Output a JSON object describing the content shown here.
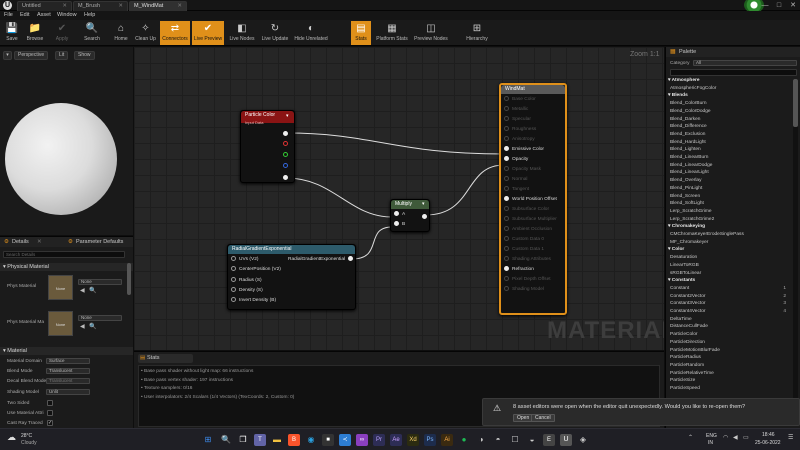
{
  "window": {
    "tabs": [
      "Untitled",
      "M_Brush",
      "M_WindMat"
    ],
    "controls": [
      "—",
      "□",
      "✕"
    ]
  },
  "menu": [
    "File",
    "Edit",
    "Asset",
    "Window",
    "Help"
  ],
  "toolbar": [
    {
      "label": "Save",
      "icon": "💾",
      "state": "normal"
    },
    {
      "label": "Browse",
      "icon": "📁",
      "state": "normal"
    },
    {
      "label": "Apply",
      "icon": "✔",
      "state": "disabled"
    },
    {
      "label": "Search",
      "icon": "🔍",
      "state": "normal"
    },
    {
      "label": "Home",
      "icon": "⌂",
      "state": "normal"
    },
    {
      "label": "Clean Up",
      "icon": "✧",
      "state": "normal"
    },
    {
      "label": "Connectors",
      "icon": "⇄",
      "state": "active"
    },
    {
      "label": "Live Preview",
      "icon": "✔",
      "state": "active"
    },
    {
      "label": "Live Nodes",
      "icon": "◧",
      "state": "normal"
    },
    {
      "label": "Live Update",
      "icon": "↻",
      "state": "normal"
    },
    {
      "label": "Hide Unrelated",
      "icon": "◐",
      "state": "normal"
    },
    {
      "label": "Stats",
      "icon": "▤",
      "state": "active"
    },
    {
      "label": "Platform Stats",
      "icon": "▦",
      "state": "normal"
    },
    {
      "label": "Preview Nodes",
      "icon": "◫",
      "state": "normal"
    },
    {
      "label": "Hierarchy",
      "icon": "⊞",
      "state": "normal"
    }
  ],
  "viewport": {
    "buttons": [
      "Perspective",
      "Lit",
      "Show"
    ]
  },
  "details": {
    "tabs": [
      "Details",
      "Parameter Defaults"
    ],
    "search_placeholder": "Search Details",
    "section_physical": "Physical Material",
    "phys_material_label": "Phys Material",
    "phys_material_mask_label": "Phys Material Ma",
    "thumb_label": "None",
    "none_value": "None",
    "section_material": "Material",
    "rows": [
      {
        "label": "Material Domain",
        "value": "Surface"
      },
      {
        "label": "Blend Mode",
        "value": "Translucent"
      },
      {
        "label": "Decal Blend Mode",
        "value": "Translucent"
      },
      {
        "label": "Shading Model",
        "value": "Unlit"
      },
      {
        "label": "Two Sided",
        "value": ""
      },
      {
        "label": "Use Material Attri",
        "value": ""
      },
      {
        "label": "Cast Ray Traced",
        "value": "✓"
      }
    ]
  },
  "graph": {
    "zoom": "Zoom 1:1",
    "watermark": "MATERIAL",
    "particle_color": {
      "title": "Particle Color",
      "subtitle": "Input Data"
    },
    "multiply": {
      "title": "Multiply",
      "pins": [
        "A",
        "B"
      ]
    },
    "radial": {
      "title": "RadialGradientExponential",
      "output": "RadialGradientExponential",
      "pins": [
        "UVs (V2)",
        "CenterPosition (V2)",
        "Radius (S)",
        "Density (S)",
        "Invert Density (B)"
      ]
    },
    "windmat": {
      "title": "WindMat",
      "pins": [
        {
          "label": "Base Color",
          "enabled": false
        },
        {
          "label": "Metallic",
          "enabled": false
        },
        {
          "label": "Specular",
          "enabled": false
        },
        {
          "label": "Roughness",
          "enabled": false
        },
        {
          "label": "Anisotropy",
          "enabled": false
        },
        {
          "label": "Emissive Color",
          "enabled": true
        },
        {
          "label": "Opacity",
          "enabled": true
        },
        {
          "label": "Opacity Mask",
          "enabled": false
        },
        {
          "label": "Normal",
          "enabled": false
        },
        {
          "label": "Tangent",
          "enabled": false
        },
        {
          "label": "World Position Offset",
          "enabled": true
        },
        {
          "label": "Subsurface Color",
          "enabled": false
        },
        {
          "label": "Subsurface Multiplier",
          "enabled": false
        },
        {
          "label": "Ambient Occlusion",
          "enabled": false
        },
        {
          "label": "Custom Data 0",
          "enabled": false
        },
        {
          "label": "Custom Data 1",
          "enabled": false
        },
        {
          "label": "Shading Attributes",
          "enabled": false
        },
        {
          "label": "Refraction",
          "enabled": true
        },
        {
          "label": "Pixel Depth Offset",
          "enabled": false
        },
        {
          "label": "Shading Model",
          "enabled": false
        }
      ]
    }
  },
  "stats": {
    "tab": "Stats",
    "lines": [
      "Base pass shader without light map: 66 instructions",
      "Base pass vertex shader: 197 instructions",
      "Texture samplers: 0/16",
      "User interpolators: 2/4 Scalars (1/4 Vectors) (TexCoords: 2, Custom: 0)"
    ]
  },
  "palette": {
    "title": "Palette",
    "category_label": "Category",
    "category_value": "All",
    "items": [
      {
        "t": "cat",
        "label": "Atmosphere"
      },
      {
        "t": "item",
        "label": "AtmosphericFogColor"
      },
      {
        "t": "cat",
        "label": "Blends"
      },
      {
        "t": "item",
        "label": "Blend_ColorBurn"
      },
      {
        "t": "item",
        "label": "Blend_ColorDodge"
      },
      {
        "t": "item",
        "label": "Blend_Darken"
      },
      {
        "t": "item",
        "label": "Blend_Difference"
      },
      {
        "t": "item",
        "label": "Blend_Exclusion"
      },
      {
        "t": "item",
        "label": "Blend_HardLight"
      },
      {
        "t": "item",
        "label": "Blend_Lighten"
      },
      {
        "t": "item",
        "label": "Blend_LinearBurn"
      },
      {
        "t": "item",
        "label": "Blend_LinearDodge"
      },
      {
        "t": "item",
        "label": "Blend_LinearLight"
      },
      {
        "t": "item",
        "label": "Blend_Overlay"
      },
      {
        "t": "item",
        "label": "Blend_PinLight"
      },
      {
        "t": "item",
        "label": "Blend_Screen"
      },
      {
        "t": "item",
        "label": "Blend_SoftLight"
      },
      {
        "t": "item",
        "label": "Lerp_ScratchGrime"
      },
      {
        "t": "item",
        "label": "Lerp_ScratchGrime2"
      },
      {
        "t": "cat",
        "label": "Chromakeying"
      },
      {
        "t": "item",
        "label": "CMChromaKeyerErodeSinglePass"
      },
      {
        "t": "item",
        "label": "MF_Chromakeyer"
      },
      {
        "t": "cat",
        "label": "Color"
      },
      {
        "t": "item",
        "label": "Desaturation"
      },
      {
        "t": "item",
        "label": "LinearToRGB"
      },
      {
        "t": "item",
        "label": "sRGBToLinear"
      },
      {
        "t": "cat",
        "label": "Constants"
      },
      {
        "t": "item",
        "label": "Constant",
        "num": "1"
      },
      {
        "t": "item",
        "label": "Constant2Vector",
        "num": "2"
      },
      {
        "t": "item",
        "label": "Constant3Vector",
        "num": "3"
      },
      {
        "t": "item",
        "label": "Constant4Vector",
        "num": "4"
      },
      {
        "t": "item",
        "label": "DeltaTime"
      },
      {
        "t": "item",
        "label": "DistanceCullFade"
      },
      {
        "t": "item",
        "label": "ParticleColor"
      },
      {
        "t": "item",
        "label": "ParticleDirection"
      },
      {
        "t": "item",
        "label": "ParticleMotionBlurFade"
      },
      {
        "t": "item",
        "label": "ParticleRadius"
      },
      {
        "t": "item",
        "label": "ParticleRandom"
      },
      {
        "t": "item",
        "label": "ParticleRelativeTime"
      },
      {
        "t": "item",
        "label": "ParticleSize"
      },
      {
        "t": "item",
        "label": "ParticleSpeed"
      }
    ]
  },
  "notification": {
    "text": "8 asset editors were open when the editor quit unexpectedly. Would you like to re-open them?",
    "open": "Open",
    "cancel": "Cancel"
  },
  "taskbar": {
    "weather_temp": "28°C",
    "weather_desc": "Cloudy",
    "lang": "ENG",
    "region": "IN",
    "time": "18:46",
    "date": "25-06-2022"
  }
}
